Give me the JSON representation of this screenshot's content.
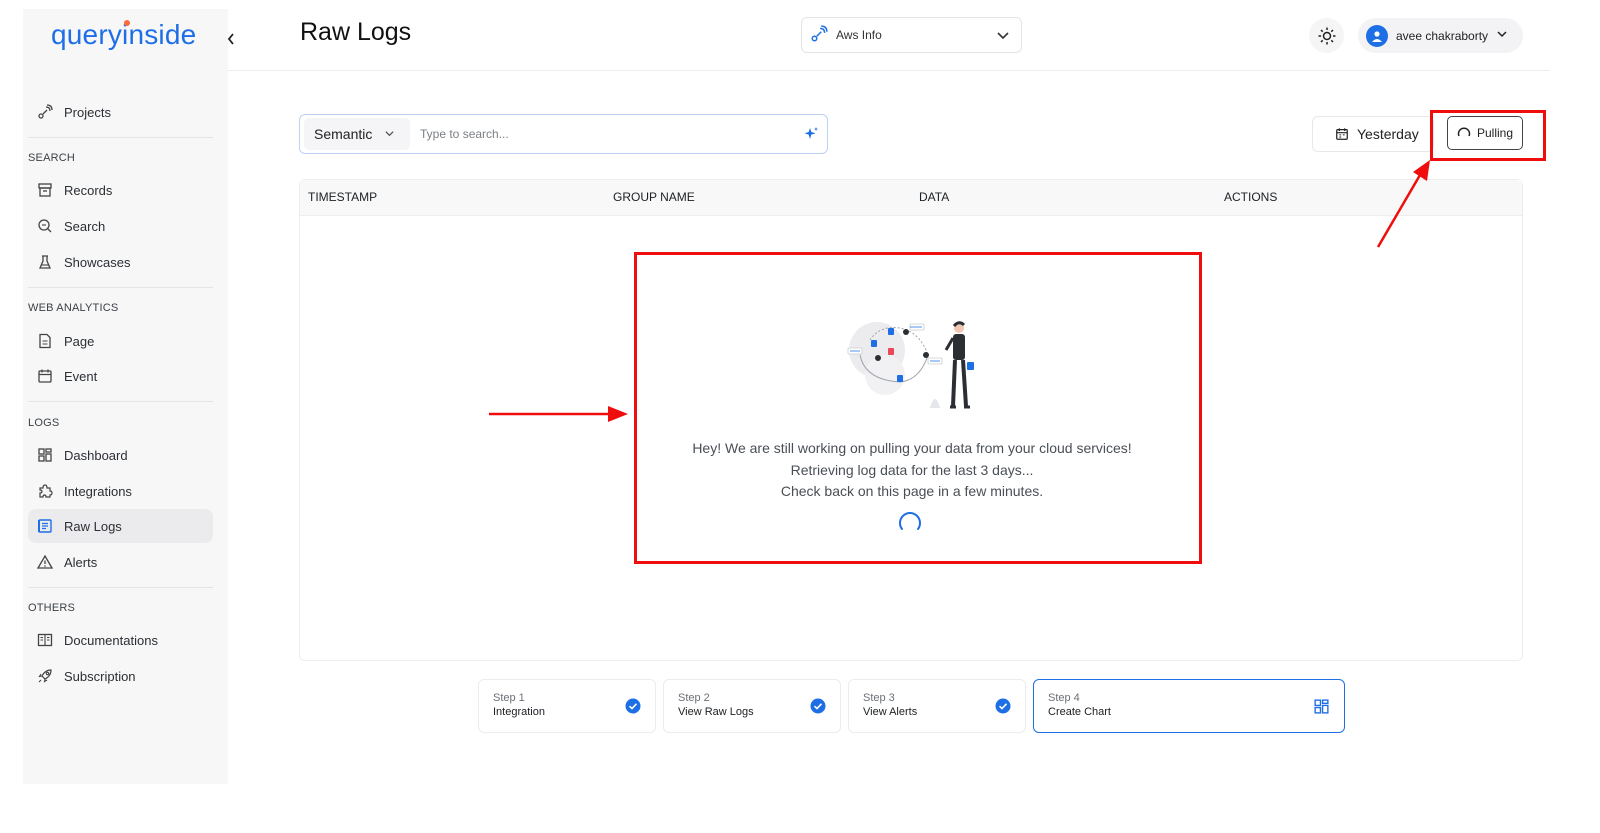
{
  "app": {
    "brand": "queryinside"
  },
  "sidebar": {
    "top_items": [
      {
        "label": "Projects",
        "icon": "satellite-icon"
      }
    ],
    "sections": [
      {
        "title": "SEARCH",
        "items": [
          {
            "label": "Records",
            "icon": "archive-icon"
          },
          {
            "label": "Search",
            "icon": "search-icon"
          },
          {
            "label": "Showcases",
            "icon": "flask-icon"
          }
        ]
      },
      {
        "title": "WEB ANALYTICS",
        "items": [
          {
            "label": "Page",
            "icon": "document-icon"
          },
          {
            "label": "Event",
            "icon": "calendar-icon"
          }
        ]
      },
      {
        "title": "LOGS",
        "items": [
          {
            "label": "Dashboard",
            "icon": "grid-icon"
          },
          {
            "label": "Integrations",
            "icon": "puzzle-icon"
          },
          {
            "label": "Raw Logs",
            "icon": "logs-icon",
            "active": true
          },
          {
            "label": "Alerts",
            "icon": "warning-icon"
          }
        ]
      },
      {
        "title": "OTHERS",
        "items": [
          {
            "label": "Documentations",
            "icon": "book-icon"
          },
          {
            "label": "Subscription",
            "icon": "rocket-icon"
          }
        ]
      }
    ]
  },
  "header": {
    "title": "Raw Logs",
    "project_select": "Aws Info",
    "user_name": "avee chakraborty"
  },
  "toolbar": {
    "search_mode": "Semantic",
    "search_placeholder": "Type to search...",
    "date_label": "Yesterday",
    "pull_label": "Pulling"
  },
  "table": {
    "columns": [
      "TIMESTAMP",
      "GROUP NAME",
      "DATA",
      "ACTIONS"
    ],
    "empty_lines": [
      "Hey! We are still working on pulling your data from your cloud services!",
      "Retrieving log data for the last 3 days...",
      "Check back on this page in a few minutes."
    ]
  },
  "steps": [
    {
      "num": "Step 1",
      "label": "Integration",
      "status": "done"
    },
    {
      "num": "Step 2",
      "label": "View Raw Logs",
      "status": "done"
    },
    {
      "num": "Step 3",
      "label": "View Alerts",
      "status": "done"
    },
    {
      "num": "Step 4",
      "label": "Create Chart",
      "status": "current"
    }
  ],
  "colors": {
    "accent": "#1e6fe6",
    "annotation": "#ef0d0d",
    "sidebar_bg": "#f7f7f8"
  }
}
